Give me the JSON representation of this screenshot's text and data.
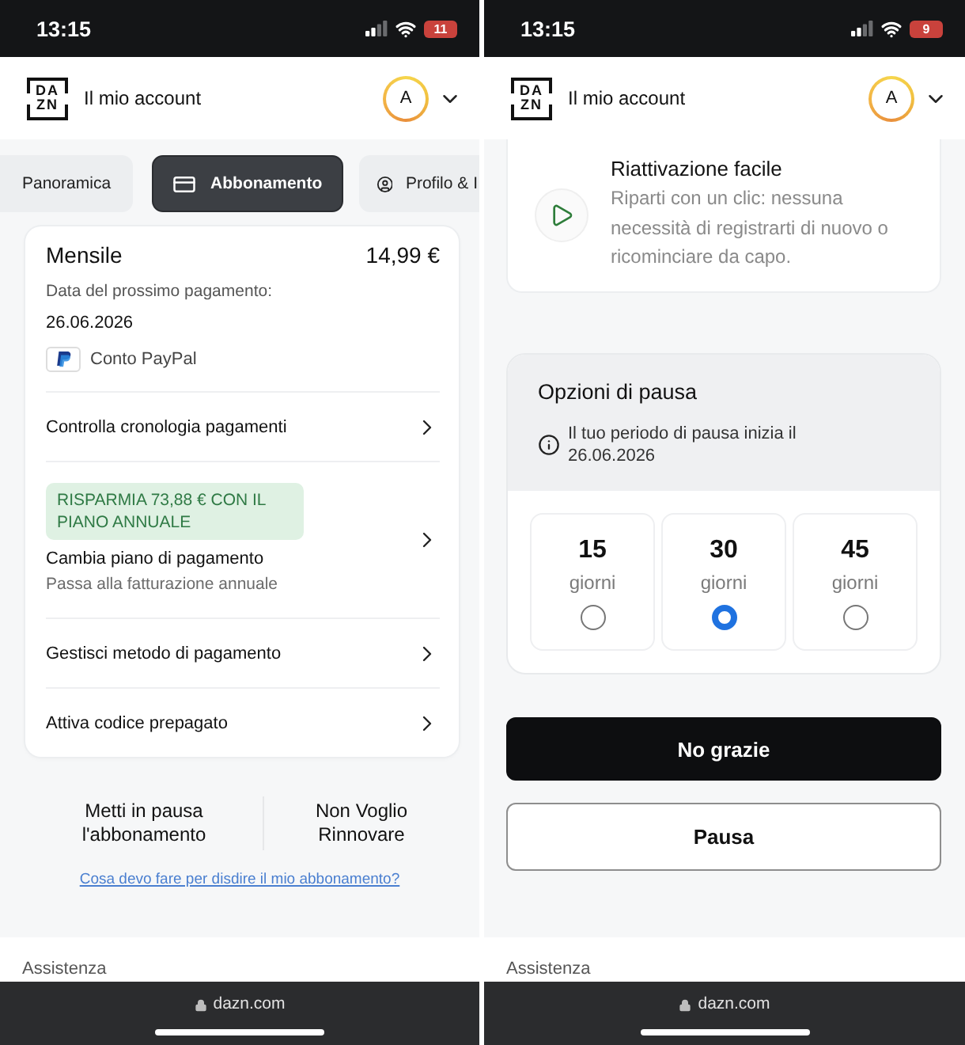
{
  "subscription_screen": {
    "status_bar": {
      "time": "13:15",
      "battery": "11"
    },
    "header": {
      "logo": [
        "DA",
        "ZN"
      ],
      "title": "Il mio account",
      "avatar_initial": "A"
    },
    "tabs": [
      {
        "label": "Panoramica",
        "selected": false
      },
      {
        "label": "Abbonamento",
        "selected": true
      },
      {
        "label": "Profilo & I",
        "selected": false
      }
    ],
    "plan": {
      "name": "Mensile",
      "price": "14,99 €",
      "next_payment_label": "Data del prossimo pagamento:",
      "next_payment_date": "26.06.2026",
      "payment_method": "Conto PayPal"
    },
    "rows": [
      {
        "label": "Controlla cronologia pagamenti"
      },
      {
        "badge": "RISPARMIA 73,88 € CON IL PIANO ANNUALE",
        "label": "Cambia piano di pagamento",
        "description": "Passa alla fatturazione annuale"
      },
      {
        "label": "Gestisci metodo di pagamento"
      },
      {
        "label": "Attiva codice prepagato"
      }
    ],
    "actions": [
      "Metti in pausa l'abbonamento",
      "Non Voglio Rinnovare"
    ],
    "help_link": "Cosa devo fare per disdire il mio abbonamento?",
    "footer": "Assistenza",
    "browser_bar": {
      "url": "dazn.com"
    }
  },
  "pause_screen": {
    "status_bar": {
      "time": "13:15",
      "battery": "9"
    },
    "header": {
      "logo": [
        "DA",
        "ZN"
      ],
      "title": "Il mio account",
      "avatar_initial": "A"
    },
    "feature": {
      "title": "Riattivazione facile",
      "description": "Riparti con un clic: nessuna necessità di registrarti di nuovo o ricominciare da capo."
    },
    "pause_options": {
      "title": "Opzioni di pausa",
      "info": "Il tuo periodo di pausa inizia il 26.06.2026",
      "options": [
        {
          "days": "15",
          "unit": "giorni",
          "selected": false
        },
        {
          "days": "30",
          "unit": "giorni",
          "selected": true
        },
        {
          "days": "45",
          "unit": "giorni",
          "selected": false
        }
      ]
    },
    "buttons": [
      {
        "kind": "primary",
        "label": "No grazie"
      },
      {
        "kind": "secondary",
        "label": "Pausa"
      }
    ],
    "footer": "Assistenza",
    "browser_bar": {
      "url": "dazn.com"
    }
  }
}
